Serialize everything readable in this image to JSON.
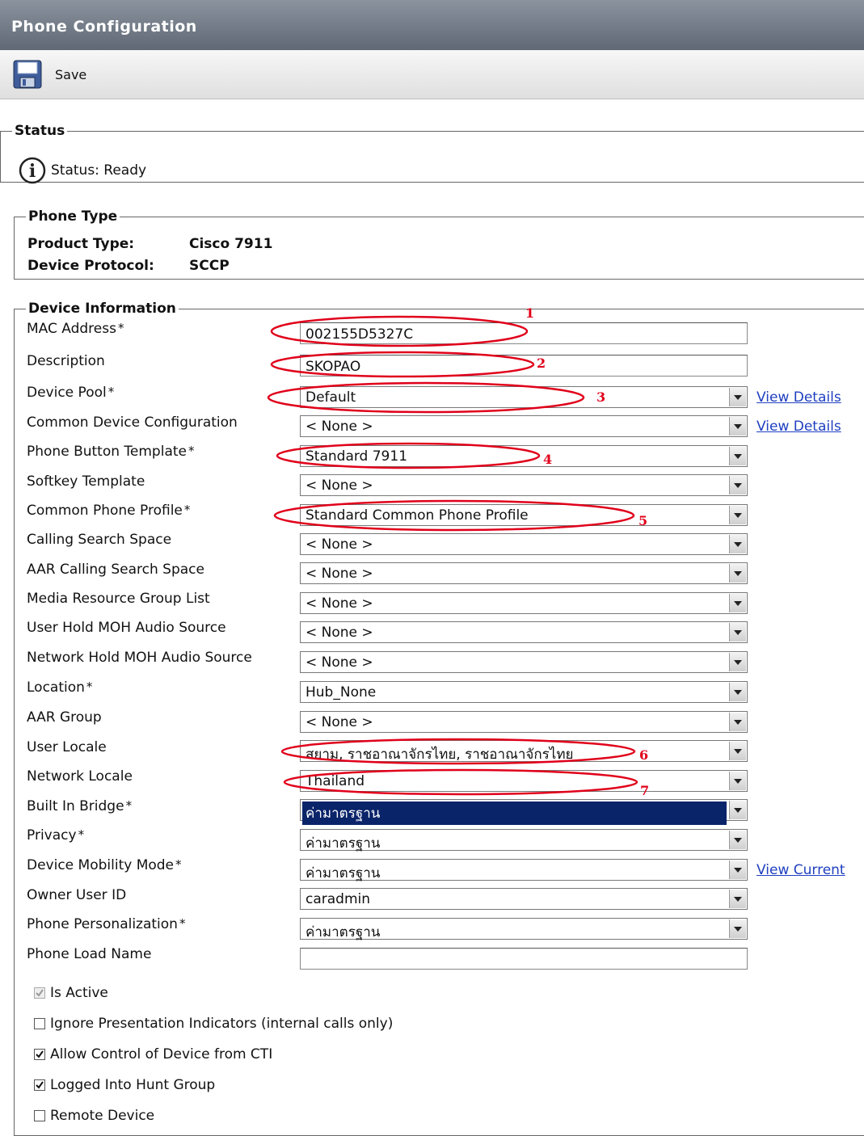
{
  "header": {
    "title": "Phone Configuration"
  },
  "toolbar": {
    "save_label": "Save"
  },
  "status": {
    "legend": "Status",
    "text": "Status: Ready",
    "icon": "info-icon"
  },
  "phone_type": {
    "legend": "Phone Type",
    "product_type_label": "Product Type:",
    "product_type_value": "Cisco 7911",
    "protocol_label": "Device Protocol:",
    "protocol_value": "SCCP"
  },
  "device_info": {
    "legend": "Device Information",
    "mac_address": {
      "label": "MAC Address",
      "value": "002155D5327C",
      "required": "*"
    },
    "description": {
      "label": "Description",
      "value": "SKOPAO"
    },
    "device_pool": {
      "label": "Device Pool",
      "value": "Default",
      "required": "*",
      "link": "View Details"
    },
    "common_device_config": {
      "label": "Common Device Configuration",
      "value": "< None >",
      "link": "View Details"
    },
    "phone_button_template": {
      "label": "Phone Button Template",
      "value": "Standard 7911",
      "required": "*"
    },
    "softkey_template": {
      "label": "Softkey Template",
      "value": "< None >"
    },
    "common_phone_profile": {
      "label": "Common Phone Profile",
      "value": "Standard Common Phone Profile",
      "required": "*"
    },
    "calling_search_space": {
      "label": "Calling Search Space",
      "value": "< None >"
    },
    "aar_calling_search_space": {
      "label": "AAR Calling Search Space",
      "value": "< None >"
    },
    "media_resource_group_list": {
      "label": "Media Resource Group List",
      "value": "< None >"
    },
    "user_hold_moh": {
      "label": "User Hold MOH Audio Source",
      "value": "< None >"
    },
    "network_hold_moh": {
      "label": "Network Hold MOH Audio Source",
      "value": "< None >"
    },
    "location": {
      "label": "Location",
      "value": "Hub_None",
      "required": "*"
    },
    "aar_group": {
      "label": "AAR Group",
      "value": "< None >"
    },
    "user_locale": {
      "label": "User Locale",
      "value": "สยาม, ราชอาณาจักรไทย, ราชอาณาจักรไทย"
    },
    "network_locale": {
      "label": "Network Locale",
      "value": "Thailand"
    },
    "built_in_bridge": {
      "label": "Built In Bridge",
      "value": "ค่ามาตรฐาน",
      "required": "*"
    },
    "privacy": {
      "label": "Privacy",
      "value": "ค่ามาตรฐาน",
      "required": "*"
    },
    "device_mobility_mode": {
      "label": "Device Mobility Mode",
      "value": "ค่ามาตรฐาน",
      "required": "*",
      "link": "View Current"
    },
    "owner_user_id": {
      "label": "Owner User ID",
      "value": "caradmin"
    },
    "phone_personalization": {
      "label": "Phone Personalization",
      "value": "ค่ามาตรฐาน",
      "required": "*"
    },
    "phone_load_name": {
      "label": "Phone Load Name",
      "value": ""
    },
    "checkboxes": {
      "is_active": {
        "label": "Is Active",
        "checked": true,
        "disabled": true
      },
      "ignore_presentation": {
        "label": "Ignore Presentation Indicators (internal calls only)",
        "checked": false
      },
      "allow_cti": {
        "label": "Allow Control of Device from CTI",
        "checked": true
      },
      "logged_hunt": {
        "label": "Logged Into Hunt Group",
        "checked": true
      },
      "remote_device": {
        "label": "Remote Device",
        "checked": false
      }
    }
  },
  "annotations": [
    "1",
    "2",
    "3",
    "4",
    "5",
    "6",
    "7"
  ],
  "colors": {
    "annotation": "#e0001a",
    "link": "#1f3fbf",
    "header": "#6b7480",
    "selection": "#0a246a"
  }
}
